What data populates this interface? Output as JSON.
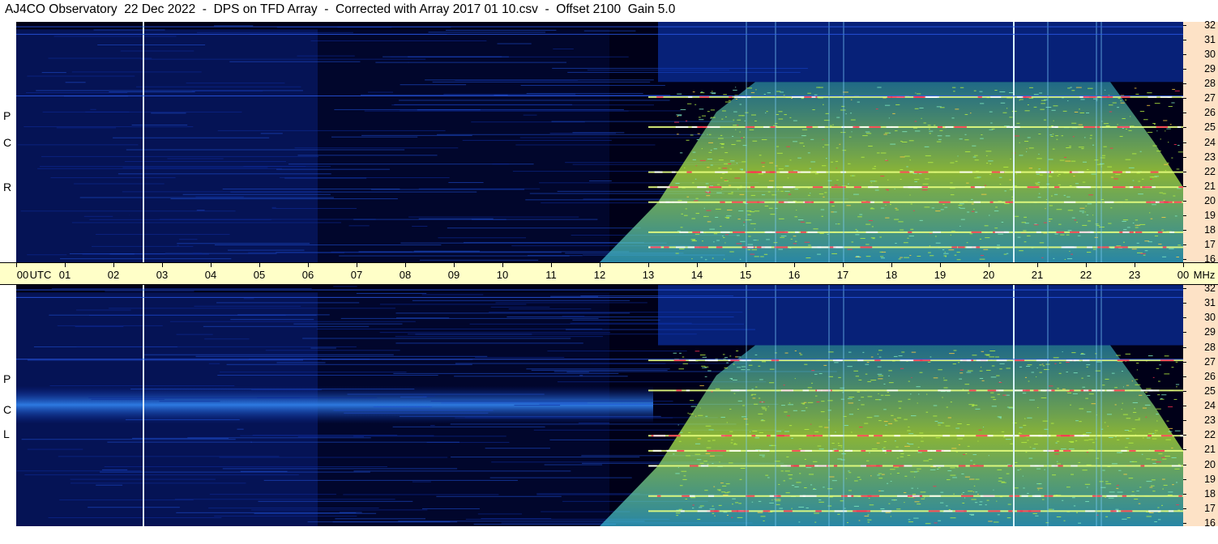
{
  "title": "AJ4CO Observatory  22 Dec 2022  -  DPS on TFD Array  -  Corrected with Array 2017 01 10.csv  -  Offset 2100  Gain 5.0",
  "chart_data": [
    {
      "type": "heatmap",
      "panel": "RCP",
      "side_label": [
        "R",
        "C",
        "P"
      ],
      "x_ticks": [
        "00",
        "01",
        "02",
        "03",
        "04",
        "05",
        "06",
        "07",
        "08",
        "09",
        "10",
        "11",
        "12",
        "13",
        "14",
        "15",
        "16",
        "17",
        "18",
        "19",
        "20",
        "21",
        "22",
        "23",
        "00"
      ],
      "x_range": [
        0,
        24
      ],
      "y_ticks": [
        16,
        17,
        18,
        19,
        20,
        21,
        22,
        23,
        24,
        25,
        26,
        27,
        28,
        29,
        30,
        31,
        32
      ],
      "y_range": [
        16,
        32
      ],
      "activity_start_hours": 12,
      "activity_end_hours": 24,
      "strong_bands_mhz": [
        27,
        25,
        22,
        21,
        20,
        18,
        17
      ],
      "vertical_markers_hours": [
        2.6,
        20.5
      ]
    },
    {
      "type": "heatmap",
      "panel": "LCP",
      "side_label": [
        "L",
        "C",
        "P"
      ],
      "x_ticks": [
        "00",
        "01",
        "02",
        "03",
        "04",
        "05",
        "06",
        "07",
        "08",
        "09",
        "10",
        "11",
        "12",
        "13",
        "14",
        "15",
        "16",
        "17",
        "18",
        "19",
        "20",
        "21",
        "22",
        "23",
        "00"
      ],
      "x_range": [
        0,
        24
      ],
      "y_ticks": [
        16,
        17,
        18,
        19,
        20,
        21,
        22,
        23,
        24,
        25,
        26,
        27,
        28,
        29,
        30,
        31,
        32
      ],
      "y_range": [
        16,
        32
      ],
      "activity_start_hours": 12,
      "activity_end_hours": 24,
      "strong_bands_mhz": [
        27,
        25,
        22,
        21,
        20,
        18,
        17
      ],
      "vertical_markers_hours": [
        2.6,
        20.5
      ]
    }
  ],
  "axis": {
    "time_unit": "UTC",
    "freq_unit": "MHz"
  },
  "colors": {
    "background": "#000018",
    "low": "#0a2aa0",
    "mid": "#3ac0e0",
    "high": "#b8f040",
    "peak": "#ff3050",
    "time_axis_bg": "#ffffc8",
    "freq_axis_bg": "#fde2c6"
  }
}
